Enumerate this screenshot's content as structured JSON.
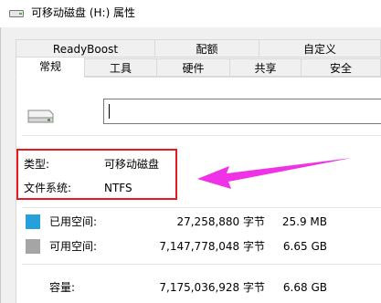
{
  "window": {
    "title": "可移动磁盘 (H:) 属性"
  },
  "tabs": [
    {
      "label": "ReadyBoost"
    },
    {
      "label": "配额"
    },
    {
      "label": "自定义"
    },
    {
      "label": "常规"
    },
    {
      "label": "工具"
    },
    {
      "label": "硬件"
    },
    {
      "label": "共享"
    },
    {
      "label": "安全"
    }
  ],
  "general": {
    "name_value": "",
    "type_label": "类型:",
    "type_value": "可移动磁盘",
    "fs_label": "文件系统:",
    "fs_value": "NTFS",
    "used_label": "已用空间:",
    "used_bytes": "27,258,880 字节",
    "used_size": "25.9 MB",
    "free_label": "可用空间:",
    "free_bytes": "7,147,778,048 字节",
    "free_size": "6.65 GB",
    "capacity_label": "容量:",
    "capacity_bytes": "7,175,036,928 字节",
    "capacity_size": "6.68 GB"
  },
  "colors": {
    "used": "#26a0da",
    "free": "#a5a5a5",
    "highlight": "#e51b23",
    "arrow": "#f032e6"
  },
  "icons": {
    "title": "removable-drive-icon",
    "drive": "removable-drive-icon"
  }
}
